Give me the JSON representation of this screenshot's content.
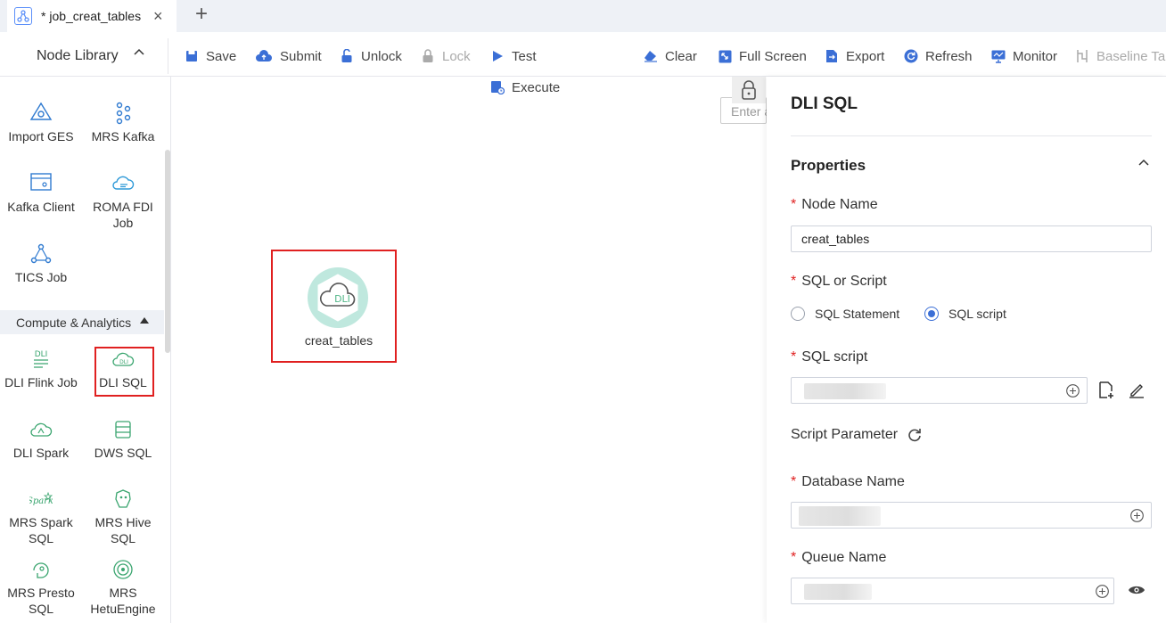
{
  "tab": {
    "title": "* job_creat_tables",
    "close": "×",
    "add": "+"
  },
  "library": {
    "title": "Node Library",
    "nodes_top": [
      {
        "label": "Import GES"
      },
      {
        "label": "MRS Kafka"
      },
      {
        "label": "Kafka Client"
      },
      {
        "label": "ROMA FDI Job"
      },
      {
        "label": "TICS Job"
      }
    ],
    "section_label": "Compute & Analytics",
    "nodes_compute": [
      {
        "label": "DLI Flink Job"
      },
      {
        "label": "DLI SQL"
      },
      {
        "label": "DLI Spark"
      },
      {
        "label": "DWS SQL"
      },
      {
        "label": "MRS Spark SQL"
      },
      {
        "label": "MRS Hive SQL"
      },
      {
        "label": "MRS Presto SQL"
      },
      {
        "label": "MRS HetuEngine"
      }
    ]
  },
  "toolbar": {
    "save": "Save",
    "submit": "Submit",
    "unlock": "Unlock",
    "lock": "Lock",
    "test": "Test",
    "execute": "Execute",
    "clear": "Clear",
    "fullscreen": "Full Screen",
    "export": "Export",
    "refresh": "Refresh",
    "monitor": "Monitor",
    "baseline": "Baseline Ta"
  },
  "canvas": {
    "node_label": "creat_tables",
    "node_badge": "DLI",
    "search_placeholder": "Enter a"
  },
  "properties": {
    "panel_title": "DLI SQL",
    "section_title": "Properties",
    "node_name_label": "Node Name",
    "node_name_value": "creat_tables",
    "sql_or_script_label": "SQL or Script",
    "option_statement": "SQL Statement",
    "option_script": "SQL script",
    "sql_script_label": "SQL script",
    "script_param_label": "Script Parameter",
    "database_label": "Database Name",
    "queue_label": "Queue Name",
    "required_mark": "*"
  },
  "colors": {
    "accent": "#3b6fd6",
    "highlight": "#e02020",
    "node_green": "#52b788",
    "dli_bg": "#bfe8de"
  }
}
